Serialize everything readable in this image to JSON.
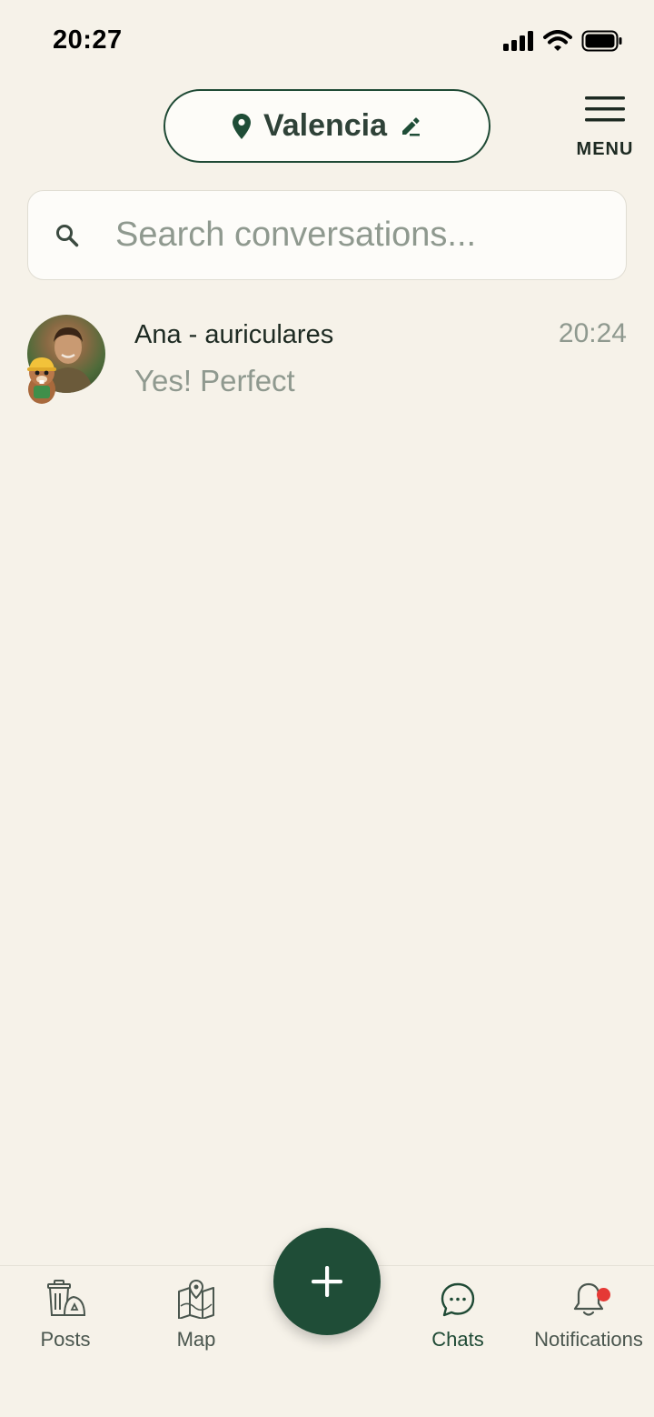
{
  "status_bar": {
    "time": "20:27",
    "icons": [
      "signal-icon",
      "wifi-icon",
      "battery-icon"
    ]
  },
  "header": {
    "location": "Valencia",
    "menu_label": "MENU"
  },
  "search": {
    "placeholder": "Search conversations..."
  },
  "conversations": [
    {
      "name": "Ana - auriculares",
      "time": "20:24",
      "preview": "Yes! Perfect"
    }
  ],
  "bottom_nav": {
    "items": [
      {
        "label": "Posts",
        "icon": "recycle-bin-icon"
      },
      {
        "label": "Map",
        "icon": "map-icon"
      },
      {
        "label": "Chats",
        "icon": "chat-icon",
        "active": true
      },
      {
        "label": "Notifications",
        "icon": "bell-icon",
        "has_badge": true
      }
    ],
    "fab_icon": "plus-icon"
  },
  "colors": {
    "background": "#f6f2e9",
    "brand_green": "#1f4d37",
    "muted_text": "#8f998f",
    "badge_red": "#e53935"
  }
}
